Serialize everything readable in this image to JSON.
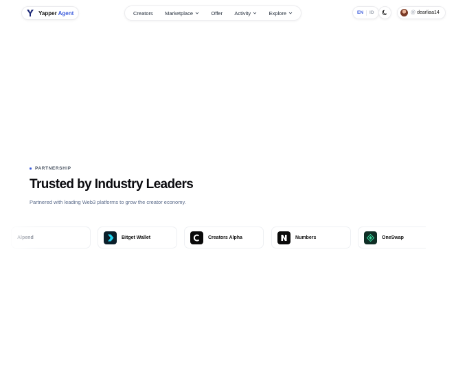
{
  "brand": {
    "name": "Yapper",
    "suffix": "Agent"
  },
  "nav": {
    "items": [
      {
        "label": "Creators",
        "dropdown": false
      },
      {
        "label": "Marketplace",
        "dropdown": true
      },
      {
        "label": "Offer",
        "dropdown": false
      },
      {
        "label": "Activity",
        "dropdown": true
      },
      {
        "label": "Explore",
        "dropdown": true
      }
    ]
  },
  "language": {
    "active": "EN",
    "inactive": "ID"
  },
  "theme": {
    "icon": "moon-icon"
  },
  "user": {
    "at": "@",
    "handle": "dearliaa14"
  },
  "section": {
    "eyebrow": "PARTNERSHIP",
    "title": "Trusted by Industry Leaders",
    "subtitle": "Partnered with leading Web3 platforms to grow the creator economy."
  },
  "partners": [
    {
      "name": "Alpend",
      "icon": "alpend-logo"
    },
    {
      "name": "Bitget Wallet",
      "icon": "bitget-wallet-logo"
    },
    {
      "name": "Creators Alpha",
      "icon": "creators-alpha-logo"
    },
    {
      "name": "Numbers",
      "icon": "numbers-logo"
    },
    {
      "name": "OneSwap",
      "icon": "oneswap-logo"
    }
  ],
  "colors": {
    "accent": "#3b5bdb",
    "text": "#111827",
    "muted": "#5b6b8a"
  }
}
